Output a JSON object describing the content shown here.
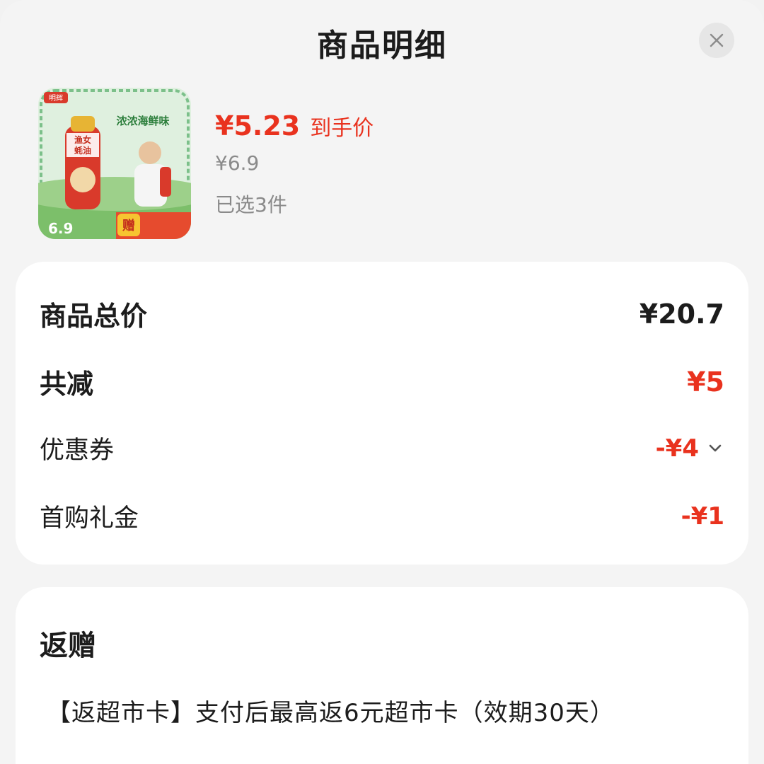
{
  "header": {
    "title": "商品明细"
  },
  "product": {
    "thumb_brand": "明辉",
    "thumb_headline": "浓浓海鲜味",
    "thumb_product_line1": "渔女",
    "thumb_product_line2": "蚝油",
    "thumb_price": "6.9",
    "thumb_badge": "赠",
    "final_price": "¥5.23",
    "final_price_label": "到手价",
    "original_price": "¥6.9",
    "selected_count": "已选3件"
  },
  "price_detail": {
    "total_label": "商品总价",
    "total_value": "¥20.7",
    "discount_label": "共减",
    "discount_value": "¥5",
    "coupon_label": "优惠券",
    "coupon_value": "-¥4",
    "first_gift_label": "首购礼金",
    "first_gift_value": "-¥1"
  },
  "gift_section": {
    "title": "返赠",
    "text": "【返超市卡】支付后最高返6元超市卡（效期30天）"
  },
  "colors": {
    "accent_red": "#e9321e",
    "background": "#f4f4f4",
    "card": "#ffffff"
  },
  "icons": {
    "close": "close-icon",
    "expand": "chevron-down-icon"
  }
}
